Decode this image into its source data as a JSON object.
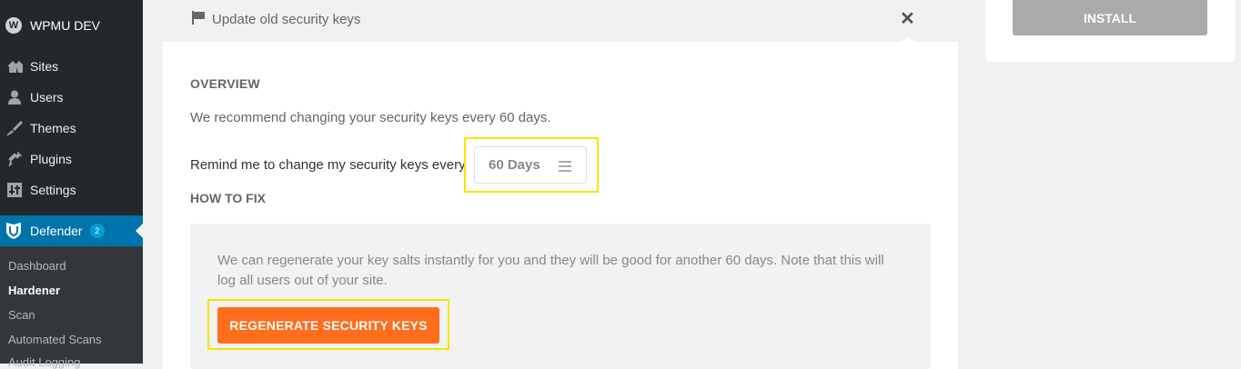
{
  "sidebar": {
    "brand": "WPMU DEV",
    "items": [
      {
        "label": "Sites",
        "icon": "sites-icon"
      },
      {
        "label": "Users",
        "icon": "user-icon"
      },
      {
        "label": "Themes",
        "icon": "brush-icon"
      },
      {
        "label": "Plugins",
        "icon": "plugin-icon"
      },
      {
        "label": "Settings",
        "icon": "settings-icon"
      }
    ],
    "active": {
      "label": "Defender",
      "badge": "2"
    },
    "submenu": [
      "Dashboard",
      "Hardener",
      "Scan",
      "Automated Scans",
      "Audit Logging"
    ],
    "current_submenu": "Hardener"
  },
  "issue": {
    "title": "Update old security keys"
  },
  "overview": {
    "heading": "OVERVIEW",
    "text": "We recommend changing your security keys every 60 days.",
    "remind_label": "Remind me to change my security keys every",
    "remind_value": "60 Days"
  },
  "how_to_fix": {
    "heading": "HOW TO FIX",
    "text": "We can regenerate your key salts instantly for you and they will be good for another 60 days. Note that this will log all users out of your site.",
    "button": "REGENERATE SECURITY KEYS"
  },
  "right_panel": {
    "install_button": "INSTALL"
  },
  "colors": {
    "sidebar_bg": "#23282d",
    "active_bg": "#0073aa",
    "regen_button": "#ff6d1d",
    "highlight": "#f5e400",
    "install_button": "#aaaaaa"
  }
}
